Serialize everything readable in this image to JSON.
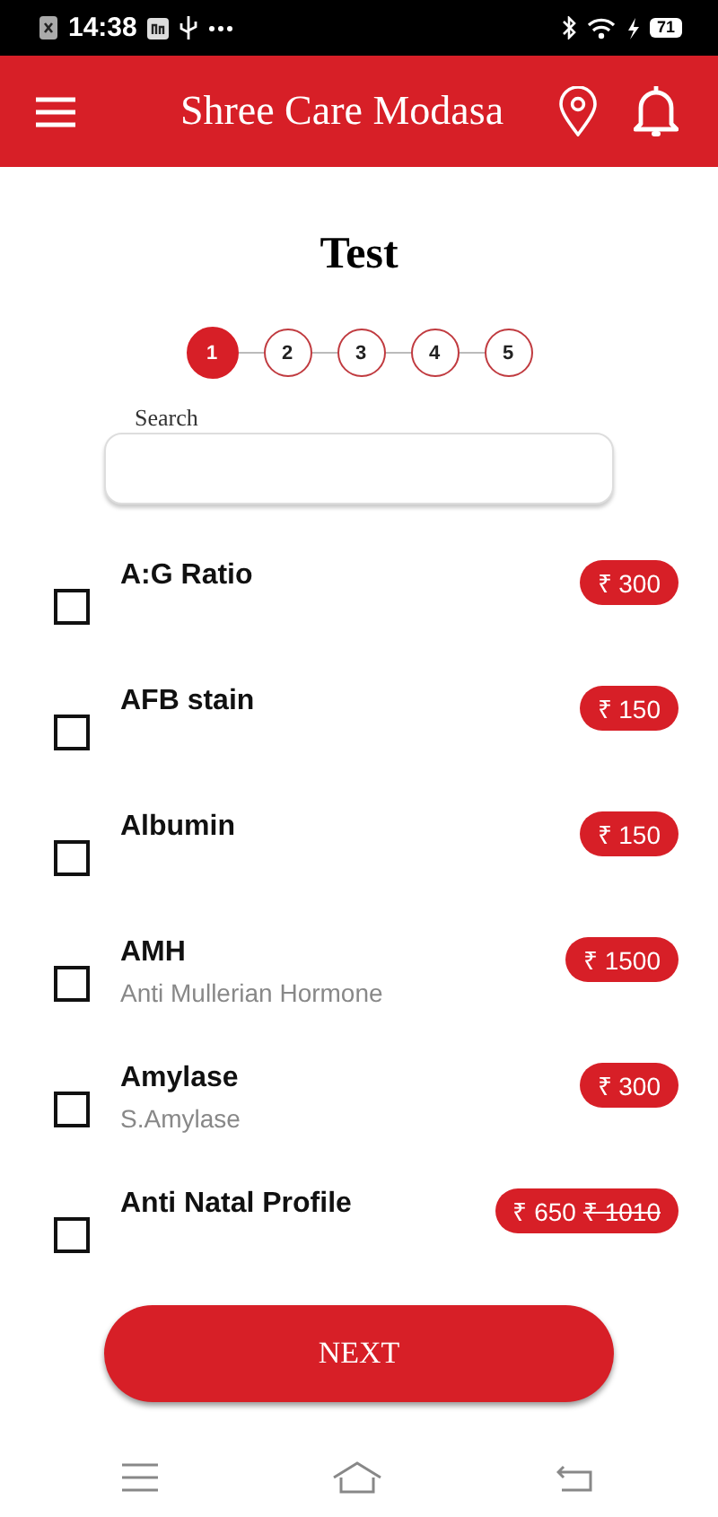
{
  "status_bar": {
    "time": "14:38",
    "battery": "71"
  },
  "header": {
    "title": "Shree Care Modasa"
  },
  "page_title": "Test",
  "steps": [
    {
      "label": "1",
      "selected": true
    },
    {
      "label": "2",
      "selected": false
    },
    {
      "label": "3",
      "selected": false
    },
    {
      "label": "4",
      "selected": false
    },
    {
      "label": "5",
      "selected": false
    }
  ],
  "search": {
    "label": "Search"
  },
  "tests": [
    {
      "name": "A:G Ratio",
      "checked": false,
      "price": "₹ 300"
    },
    {
      "name": "AFB stain",
      "checked": false,
      "price": "₹ 150"
    },
    {
      "name": "Albumin",
      "checked": false,
      "price": "₹ 150"
    },
    {
      "name": "AMH",
      "subtitle": "Anti Mullerian Hormone",
      "checked": false,
      "price": "₹ 1500"
    },
    {
      "name": "Amylase",
      "subtitle": "S.Amylase",
      "checked": false,
      "price": "₹ 300"
    },
    {
      "name": "Anti Natal Profile",
      "checked": false,
      "price": "₹ 650",
      "old_price": "₹ 1010"
    }
  ],
  "next_button": "NEXT"
}
